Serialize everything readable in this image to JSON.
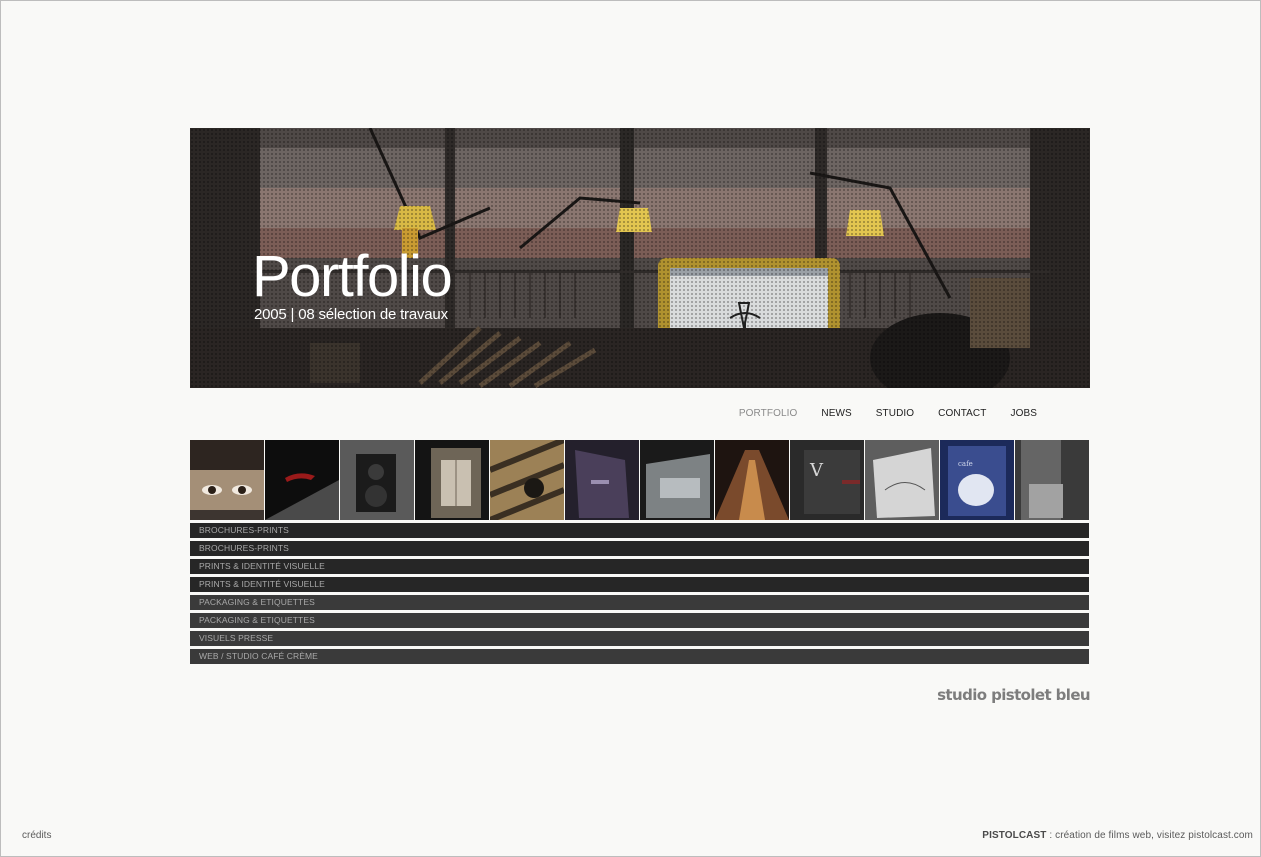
{
  "hero": {
    "title": "Portfolio",
    "subtitle": "2005 | 08 sélection de travaux"
  },
  "nav": {
    "items": [
      {
        "label": "PORTFOLIO",
        "active": true
      },
      {
        "label": "NEWS",
        "active": false
      },
      {
        "label": "STUDIO",
        "active": false
      },
      {
        "label": "CONTACT",
        "active": false
      },
      {
        "label": "JOBS",
        "active": false
      }
    ]
  },
  "categories": [
    "BROCHURES-PRINTS",
    "BROCHURES-PRINTS",
    "PRINTS & IDENTITÉ VISUELLE",
    "PRINTS & IDENTITÉ VISUELLE",
    "PACKAGING & ETIQUETTES",
    "PACKAGING & ETIQUETTES",
    "VISUELS PRESSE",
    "WEB / STUDIO CAFÉ CRÈME"
  ],
  "studio_logo": "studio pistolet bleu",
  "footer": {
    "credits": "crédits",
    "brand": "PISTOLCAST",
    "tagline": " : création de films web, visitez pistolcast.com"
  },
  "colors": {
    "background": "#f9f9f7",
    "category_bar": "#262626",
    "category_bar_light": "#3a3a3a",
    "nav_active": "#8a8a8a"
  }
}
